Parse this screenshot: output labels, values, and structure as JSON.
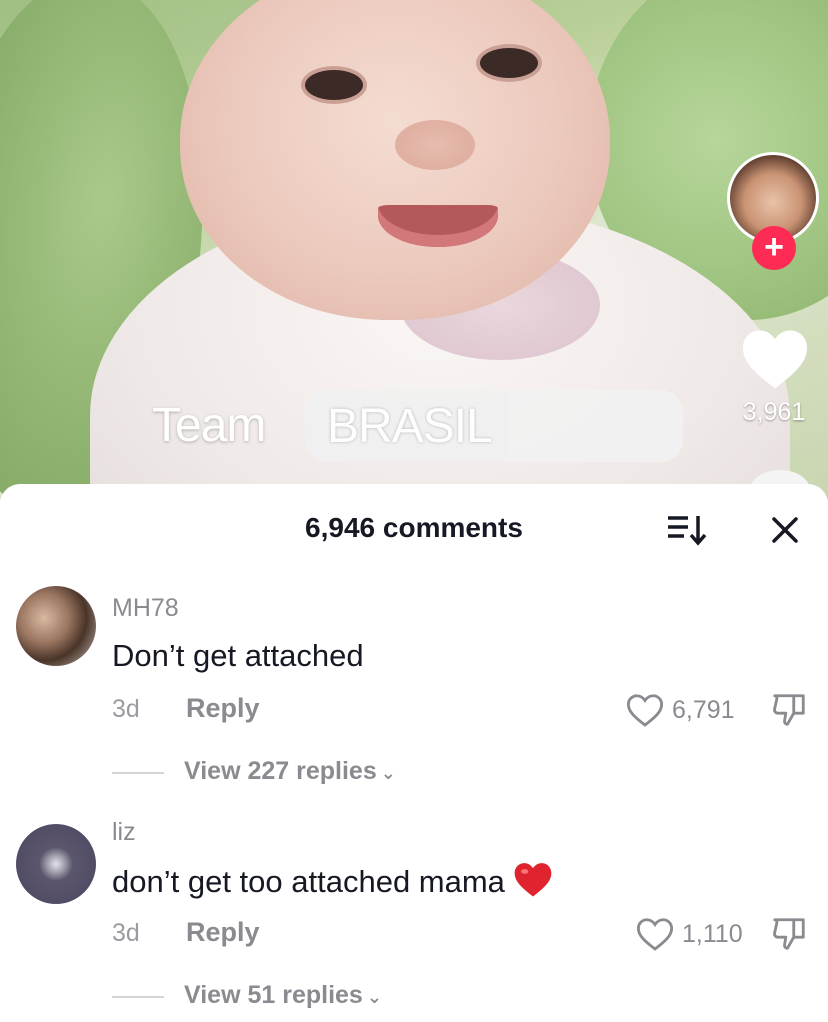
{
  "video": {
    "caption_word": "Team",
    "caption_highlight": "BRASIL",
    "like_count": "3,961"
  },
  "comments_sheet": {
    "count_label": "6,946 comments",
    "comments": [
      {
        "username": "MH78",
        "text": "Don’t get attached",
        "time": "3d",
        "reply_label": "Reply",
        "likes": "6,791",
        "view_replies": "View 227 replies"
      },
      {
        "username": "liz",
        "text": "don’t get too attached mama",
        "time": "3d",
        "reply_label": "Reply",
        "likes": "1,110",
        "view_replies": "View 51 replies"
      }
    ]
  },
  "colors": {
    "follow_accent": "#fe2c55",
    "emoji_heart": "#e0242f",
    "muted_text": "#8a8b91"
  },
  "icons": [
    "heart-icon",
    "follow-plus-icon",
    "sort-icon",
    "close-icon",
    "like-outline-icon",
    "dislike-icon",
    "chevron-down-icon",
    "red-heart-emoji"
  ]
}
